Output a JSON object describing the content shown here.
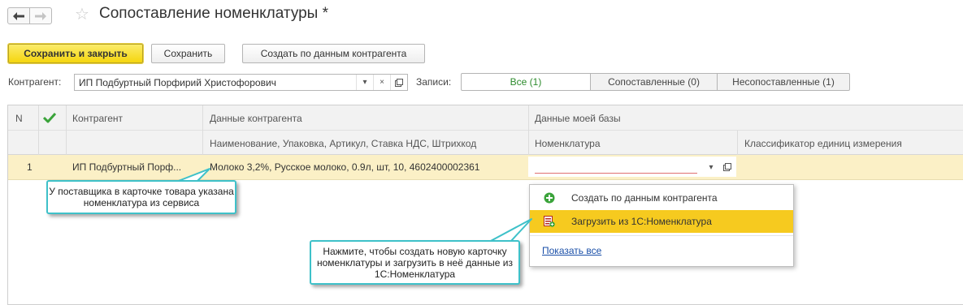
{
  "header": {
    "title": "Сопоставление номенклатуры *"
  },
  "toolbar": {
    "save_close_label": "Сохранить и закрыть",
    "save_label": "Сохранить",
    "create_from_label": "Создать по данным контрагента"
  },
  "filter": {
    "counterparty_label": "Контрагент:",
    "counterparty_value": "ИП Подбуртный Порфирий Христофорович",
    "records_label": "Записи:",
    "tabs": [
      {
        "label": "Все (1)",
        "active": true
      },
      {
        "label": "Сопоставленные (0)",
        "active": false
      },
      {
        "label": "Несопоставленные (1)",
        "active": false
      }
    ]
  },
  "table": {
    "headers": {
      "n": "N",
      "counterparty": "Контрагент",
      "counterparty_data": "Данные контрагента",
      "counterparty_data_sub": "Наименование, Упаковка, Артикул, Ставка НДС, Штрихкод",
      "my_data": "Данные моей базы",
      "nomenclature": "Номенклатура",
      "units": "Классификатор единиц измерения"
    },
    "rows": [
      {
        "n": "1",
        "counterparty": "ИП Подбуртный Порф...",
        "data": "Молоко 3,2%, Русское молоко, 0.9л, шт, 10, 4602400002361",
        "nomenclature": "",
        "units": ""
      }
    ]
  },
  "dropdown": {
    "items": [
      {
        "label": "Создать по данным контрагента",
        "icon": "plus-circle-icon"
      },
      {
        "label": "Загрузить из 1С:Номенклатура",
        "icon": "load-catalog-icon",
        "highlighted": true
      }
    ],
    "show_all": "Показать все"
  },
  "callouts": {
    "supplier_note": "У поставщика в карточке товара указана номенклатура из сервиса",
    "click_hint": "Нажмите, чтобы создать новую карточку номенклатуры и загрузить в неё данные из 1С:Номенклатура"
  },
  "colors": {
    "accent_yellow": "#f5d60e",
    "selected_row": "#fbf0c6",
    "dropdown_highlight": "#f6ca1f",
    "callout_border": "#3ec1c9",
    "check_green": "#3aa33a",
    "active_tab_text": "#2c8b2c"
  }
}
